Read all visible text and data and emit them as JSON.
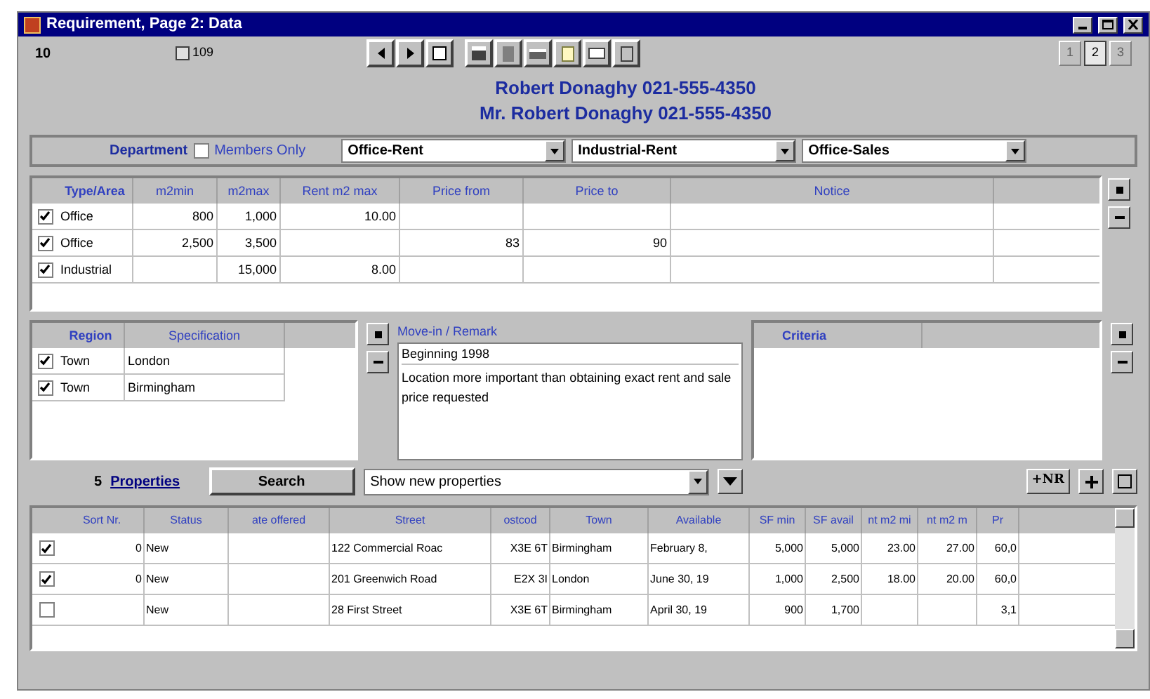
{
  "window": {
    "title": "Requirement, Page 2: Data"
  },
  "header": {
    "record": "10",
    "count": "109",
    "pages": [
      {
        "label": "1",
        "selected": false
      },
      {
        "label": "2",
        "selected": true
      },
      {
        "label": "3",
        "selected": false
      }
    ],
    "names": [
      "Robert Donaghy 021-555-4350",
      "Mr. Robert Donaghy 021-555-4350"
    ]
  },
  "filter": {
    "label": "Department",
    "members_only": {
      "label": "Members Only",
      "checked": false
    },
    "dropdowns": [
      "Office-Rent",
      "Industrial-Rent",
      "Office-Sales"
    ]
  },
  "type_table": {
    "columns": [
      "Type/Area",
      "m2min",
      "m2max",
      "Rent m2 max",
      "Price from",
      "Price to",
      "Notice"
    ],
    "rows": [
      {
        "checked": true,
        "cells": [
          "Office",
          "800",
          "1,000",
          "10.00",
          "",
          "",
          ""
        ]
      },
      {
        "checked": true,
        "cells": [
          "Office",
          "2,500",
          "3,500",
          "",
          "83",
          "90",
          ""
        ]
      },
      {
        "checked": true,
        "cells": [
          "Industrial",
          "",
          "15,000",
          "8.00",
          "",
          "",
          ""
        ]
      }
    ]
  },
  "region_table": {
    "columns": [
      "Region",
      "Specification"
    ],
    "rows": [
      {
        "checked": true,
        "cells": [
          "Town",
          "London"
        ]
      },
      {
        "checked": true,
        "cells": [
          "Town",
          "Birmingham"
        ]
      }
    ]
  },
  "remarks": {
    "label": "Move-in / Remark",
    "lines": [
      "Beginning 1998",
      "Location more important than obtaining exact rent and sale price requested"
    ]
  },
  "criteria": {
    "label": "Criteria"
  },
  "search_bar": {
    "count": "5",
    "link": "Properties",
    "search_button": "Search",
    "dropdown": "Show new properties",
    "nr_button": "+NR"
  },
  "properties_table": {
    "columns": [
      "Sort Nr.",
      "Status",
      "ate offered",
      "Street",
      "ostcod",
      "Town",
      "Available",
      "SF min",
      "SF avail",
      "nt m2 mi",
      "nt m2 m",
      "Pr"
    ],
    "rows": [
      {
        "checked": true,
        "cells": [
          "0",
          "New",
          "",
          "122 Commercial Roac",
          "X3E 6T",
          "Birmingham",
          "February 8,",
          "5,000",
          "5,000",
          "23.00",
          "27.00",
          "60,0"
        ]
      },
      {
        "checked": true,
        "cells": [
          "0",
          "New",
          "",
          "201 Greenwich Road",
          "E2X 3I",
          "London",
          "June 30, 19",
          "1,000",
          "2,500",
          "18.00",
          "20.00",
          "60,0"
        ]
      },
      {
        "checked": false,
        "cells": [
          "",
          "New",
          "",
          "28 First Street",
          "X3E 6T",
          "Birmingham",
          "April 30, 19",
          "900",
          "1,700",
          "",
          "",
          "3,1"
        ]
      }
    ]
  }
}
